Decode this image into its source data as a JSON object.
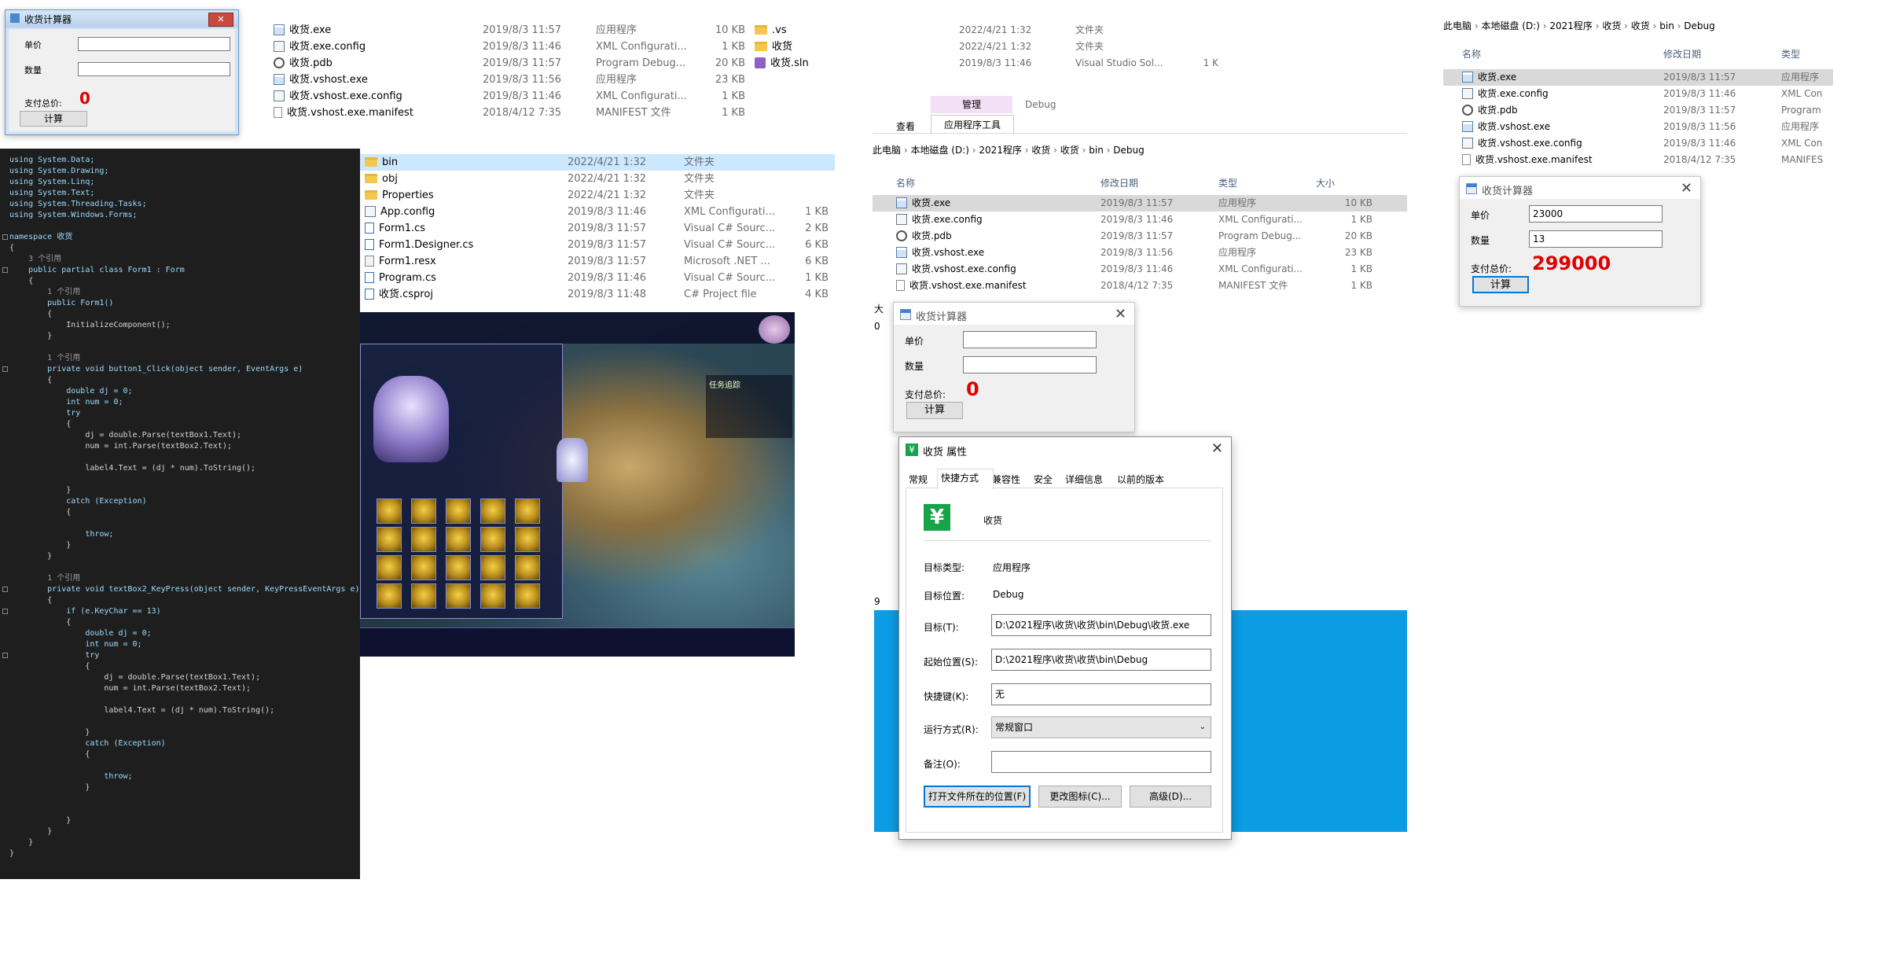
{
  "calc1": {
    "title": "收货计算器",
    "unit": "单价",
    "qty": "数量",
    "total_label": "支付总价:",
    "total": "0",
    "btn": "计算"
  },
  "explorer1": {
    "rows": [
      {
        "name": "收货.exe",
        "date": "2019/8/3 11:57",
        "type": "应用程序",
        "size": "10 KB",
        "icon": "exe"
      },
      {
        "name": "收货.exe.config",
        "date": "2019/8/3 11:46",
        "type": "XML Configurati...",
        "size": "1 KB",
        "icon": "cfg"
      },
      {
        "name": "收货.pdb",
        "date": "2019/8/3 11:57",
        "type": "Program Debug...",
        "size": "20 KB",
        "icon": "pdb"
      },
      {
        "name": "收货.vshost.exe",
        "date": "2019/8/3 11:56",
        "type": "应用程序",
        "size": "23 KB",
        "icon": "exe"
      },
      {
        "name": "收货.vshost.exe.config",
        "date": "2019/8/3 11:46",
        "type": "XML Configurati...",
        "size": "1 KB",
        "icon": "cfg"
      },
      {
        "name": "收货.vshost.exe.manifest",
        "date": "2018/4/12 7:35",
        "type": "MANIFEST 文件",
        "size": "1 KB",
        "icon": "doc"
      }
    ]
  },
  "explorer2": {
    "rows": [
      {
        "name": ".vs",
        "icon": "folder"
      },
      {
        "name": "收货",
        "icon": "folder"
      },
      {
        "name": "收货.sln",
        "icon": "sln"
      }
    ]
  },
  "explorer3": {
    "rows": [
      {
        "date": "2022/4/21 1:32",
        "type": "文件夹",
        "size": ""
      },
      {
        "date": "2022/4/21 1:32",
        "type": "文件夹",
        "size": ""
      },
      {
        "date": "2019/8/3 11:46",
        "type": "Visual Studio Sol...",
        "size": "1 K"
      }
    ]
  },
  "ribbon": {
    "context": "管理",
    "context2": "Debug",
    "tab_view": "查看",
    "tab_tools": "应用程序工具"
  },
  "explorer4": {
    "breadcrumb": [
      "此电脑",
      "本地磁盘 (D:)",
      "2021程序",
      "收货",
      "收货",
      "bin",
      "Debug"
    ],
    "headers": {
      "name": "名称",
      "date": "修改日期",
      "type": "类型",
      "size": "大小"
    },
    "rows": [
      {
        "name": "收货.exe",
        "date": "2019/8/3 11:57",
        "type": "应用程序",
        "size": "10 KB",
        "icon": "exe"
      },
      {
        "name": "收货.exe.config",
        "date": "2019/8/3 11:46",
        "type": "XML Configurati...",
        "size": "1 KB",
        "icon": "cfg"
      },
      {
        "name": "收货.pdb",
        "date": "2019/8/3 11:57",
        "type": "Program Debug...",
        "size": "20 KB",
        "icon": "pdb"
      },
      {
        "name": "收货.vshost.exe",
        "date": "2019/8/3 11:56",
        "type": "应用程序",
        "size": "23 KB",
        "icon": "exe"
      },
      {
        "name": "收货.vshost.exe.config",
        "date": "2019/8/3 11:46",
        "type": "XML Configurati...",
        "size": "1 KB",
        "icon": "cfg"
      },
      {
        "name": "收货.vshost.exe.manifest",
        "date": "2018/4/12 7:35",
        "type": "MANIFEST 文件",
        "size": "1 KB",
        "icon": "doc"
      }
    ]
  },
  "explorer5": {
    "rows": [
      {
        "name": "bin",
        "date": "2022/4/21 1:32",
        "type": "文件夹",
        "size": "",
        "icon": "folder"
      },
      {
        "name": "obj",
        "date": "2022/4/21 1:32",
        "type": "文件夹",
        "size": "",
        "icon": "folder"
      },
      {
        "name": "Properties",
        "date": "2022/4/21 1:32",
        "type": "文件夹",
        "size": "",
        "icon": "folder"
      },
      {
        "name": "App.config",
        "date": "2019/8/3 11:46",
        "type": "XML Configurati...",
        "size": "1 KB",
        "icon": "cfg"
      },
      {
        "name": "Form1.cs",
        "date": "2019/8/3 11:57",
        "type": "Visual C# Sourc...",
        "size": "2 KB",
        "icon": "cs"
      },
      {
        "name": "Form1.Designer.cs",
        "date": "2019/8/3 11:57",
        "type": "Visual C# Sourc...",
        "size": "6 KB",
        "icon": "cs"
      },
      {
        "name": "Form1.resx",
        "date": "2019/8/3 11:57",
        "type": "Microsoft .NET ...",
        "size": "6 KB",
        "icon": "resx"
      },
      {
        "name": "Program.cs",
        "date": "2019/8/3 11:46",
        "type": "Visual C# Sourc...",
        "size": "1 KB",
        "icon": "cs"
      },
      {
        "name": "收货.csproj",
        "date": "2019/8/3 11:48",
        "type": "C# Project file",
        "size": "4 KB",
        "icon": "cs"
      }
    ]
  },
  "explorer6": {
    "breadcrumb": [
      "此电脑",
      "本地磁盘 (D:)",
      "2021程序",
      "收货",
      "收货",
      "bin",
      "Debug"
    ],
    "headers": {
      "name": "名称",
      "date": "修改日期",
      "type": "类型"
    },
    "rows": [
      {
        "name": "收货.exe",
        "date": "2019/8/3 11:57",
        "type": "应用程序",
        "icon": "exe"
      },
      {
        "name": "收货.exe.config",
        "date": "2019/8/3 11:46",
        "type": "XML Con",
        "icon": "cfg"
      },
      {
        "name": "收货.pdb",
        "date": "2019/8/3 11:57",
        "type": "Program",
        "icon": "pdb"
      },
      {
        "name": "收货.vshost.exe",
        "date": "2019/8/3 11:56",
        "type": "应用程序",
        "icon": "exe"
      },
      {
        "name": "收货.vshost.exe.config",
        "date": "2019/8/3 11:46",
        "type": "XML Con",
        "icon": "cfg"
      },
      {
        "name": "收货.vshost.exe.manifest",
        "date": "2018/4/12 7:35",
        "type": "MANIFES",
        "icon": "doc"
      }
    ]
  },
  "calc2": {
    "title": "收货计算器",
    "unit": "单价",
    "qty": "数量",
    "unit_value": "23000",
    "qty_value": "13",
    "total_label": "支付总价:",
    "total": "299000",
    "btn": "计算"
  },
  "calc3": {
    "title": "收货计算器",
    "unit": "单价",
    "qty": "数量",
    "total_label": "支付总价:",
    "total": "0",
    "btn": "计算"
  },
  "props": {
    "title": "收货 属性",
    "tabs": [
      "常规",
      "快捷方式",
      "兼容性",
      "安全",
      "详细信息",
      "以前的版本"
    ],
    "active_tab": "快捷方式",
    "name": "收货",
    "target_type_label": "目标类型:",
    "target_type": "应用程序",
    "target_loc_label": "目标位置:",
    "target_loc": "Debug",
    "target_label": "目标(T):",
    "target": "D:\\2021程序\\收货\\收货\\bin\\Debug\\收货.exe",
    "start_label": "起始位置(S):",
    "start": "D:\\2021程序\\收货\\收货\\bin\\Debug",
    "hotkey_label": "快捷键(K):",
    "hotkey": "无",
    "run_label": "运行方式(R):",
    "run": "常规窗口",
    "comment_label": "备注(O):",
    "comment": "",
    "btn_open": "打开文件所在的位置(F)",
    "btn_icon": "更改图标(C)...",
    "btn_adv": "高级(D)..."
  },
  "code": {
    "lines": [
      "using System.Data;",
      "using System.Drawing;",
      "using System.Linq;",
      "using System.Text;",
      "using System.Threading.Tasks;",
      "using System.Windows.Forms;",
      "",
      "namespace 收货",
      "{",
      "    3 个引用",
      "    public partial class Form1 : Form",
      "    {",
      "        1 个引用",
      "        public Form1()",
      "        {",
      "            InitializeComponent();",
      "        }",
      "",
      "        1 个引用",
      "        private void button1_Click(object sender, EventArgs e)",
      "        {",
      "            double dj = 0;",
      "            int num = 0;",
      "            try",
      "            {",
      "                dj = double.Parse(textBox1.Text);",
      "                num = int.Parse(textBox2.Text);",
      "",
      "                label4.Text = (dj * num).ToString();",
      "",
      "            }",
      "            catch (Exception)",
      "            {",
      "",
      "                throw;",
      "            }",
      "        }",
      "",
      "        1 个引用",
      "        private void textBox2_KeyPress(object sender, KeyPressEventArgs e)",
      "        {",
      "            if (e.KeyChar == 13)",
      "            {",
      "                double dj = 0;",
      "                int num = 0;",
      "                try",
      "                {",
      "                    dj = double.Parse(textBox1.Text);",
      "                    num = int.Parse(textBox2.Text);",
      "",
      "                    label4.Text = (dj * num).ToString();",
      "",
      "                }",
      "                catch (Exception)",
      "                {",
      "",
      "                    throw;",
      "                }",
      "",
      "",
      "            }",
      "        }",
      "    }",
      "}"
    ]
  },
  "game": {
    "quest": "任务追踪"
  },
  "accent": "#0078d7"
}
